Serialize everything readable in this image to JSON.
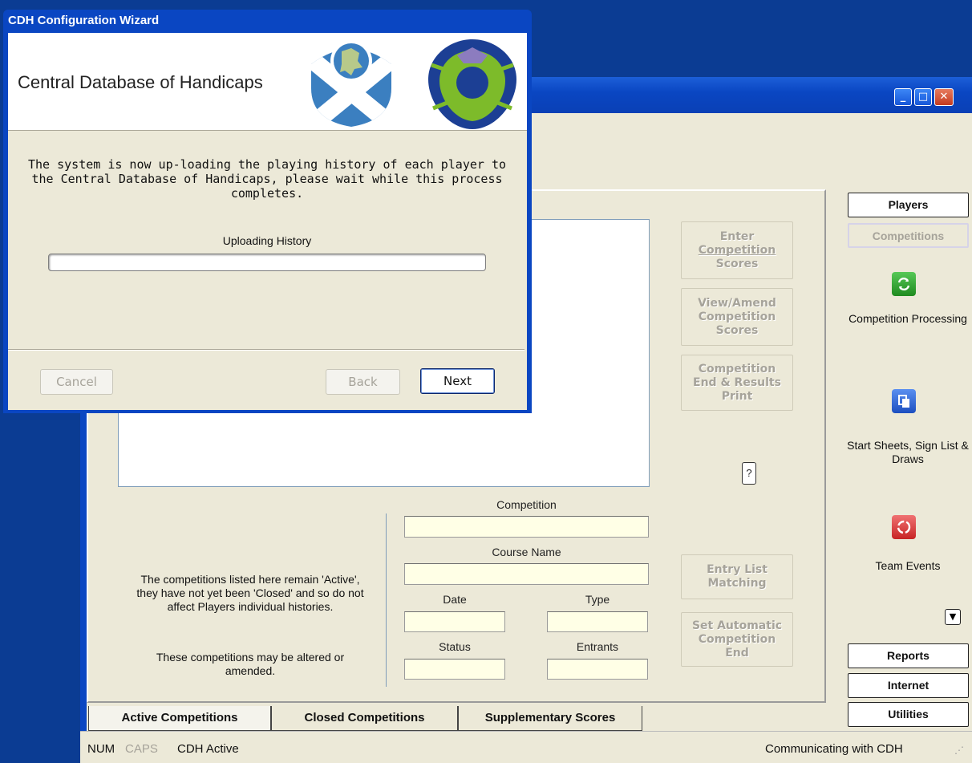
{
  "wizard": {
    "title": "CDH Configuration Wizard",
    "heading": "Central Database of Handicaps",
    "message": "The system is now up-loading the playing history of each player to the Central Database of Handicaps, please wait while this process completes.",
    "progress_label": "Uploading History",
    "progress_fraction": 0,
    "buttons": {
      "cancel": "Cancel",
      "back": "Back",
      "next": "Next"
    }
  },
  "window_controls": {
    "minimize": "_",
    "maximize": "□",
    "close": "✕"
  },
  "actions": {
    "enter_scores": [
      "Enter",
      "Competition",
      "Scores"
    ],
    "view_amend": [
      "View/Amend",
      "Competition",
      "Scores"
    ],
    "end_print": [
      "Competition",
      "End & Results",
      "Print"
    ],
    "entry_list": [
      "Entry List",
      "Matching"
    ],
    "auto_end": [
      "Set Automatic",
      "Competition",
      "End"
    ],
    "help": "?"
  },
  "form": {
    "competition_label": "Competition",
    "course_label": "Course Name",
    "date_label": "Date",
    "type_label": "Type",
    "status_label": "Status",
    "entrants_label": "Entrants",
    "competition_value": "",
    "course_value": "",
    "date_value": "",
    "type_value": "",
    "status_value": "",
    "entrants_value": ""
  },
  "notes": {
    "active_info": "The competitions listed here remain 'Active', they have not yet been 'Closed' and so do not affect Players individual histories.",
    "may_alter": "These competitions may be altered or amended."
  },
  "tabs": [
    "Active Competitions",
    "Closed Competitions",
    "Supplementary Scores"
  ],
  "nav": {
    "players": "Players",
    "competitions": "Competitions",
    "reports": "Reports",
    "internet": "Internet",
    "utilities": "Utilities"
  },
  "side_items": [
    {
      "label": "Competition Processing",
      "icon": "recycle-green-icon",
      "color": "#2e9e2e"
    },
    {
      "label": "Start Sheets, Sign List & Draws",
      "icon": "pages-blue-icon",
      "color": "#2f6fd8"
    },
    {
      "label": "Team Events",
      "icon": "recycle-red-icon",
      "color": "#d93a3a"
    }
  ],
  "status_bar": {
    "num": "NUM",
    "caps": "CAPS",
    "cdh": "CDH Active",
    "right": "Communicating with CDH"
  },
  "colors": {
    "titlebar": "#0a46c2",
    "desktop": "#0b3c93",
    "field_bg": "#ffffe6"
  }
}
